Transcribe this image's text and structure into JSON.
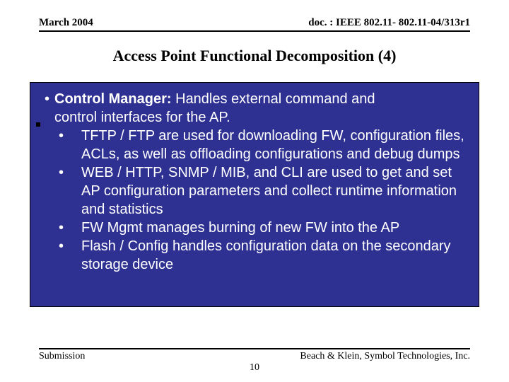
{
  "header": {
    "left": "March 2004",
    "right": "doc. : IEEE 802.11- 802.11-04/313r1"
  },
  "title": "Access Point Functional Decomposition (4)",
  "content": {
    "lead_label": "Control Manager:",
    "lead_rest": " Handles external command and",
    "lead_cont": "control interfaces for the AP.",
    "sub": [
      "TFTP / FTP are used for downloading FW, configuration files, ACLs, as well as offloading configurations and debug dumps",
      "WEB / HTTP, SNMP / MIB, and CLI are used to get and set AP configuration parameters and collect runtime information and statistics",
      "FW Mgmt manages burning of new FW into the AP",
      "Flash / Config handles configuration data on the secondary storage device"
    ]
  },
  "footer": {
    "left": "Submission",
    "center": "10",
    "right": "Beach & Klein, Symbol Technologies, Inc."
  }
}
